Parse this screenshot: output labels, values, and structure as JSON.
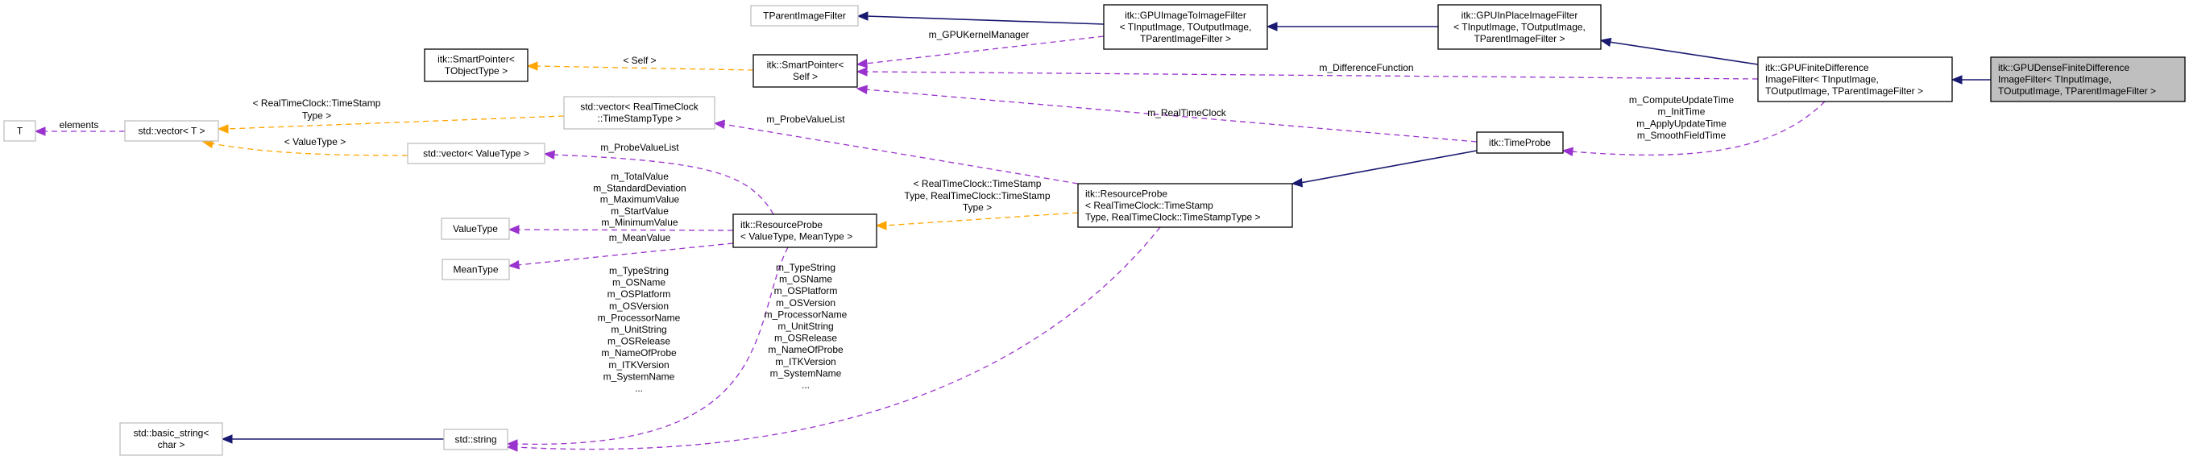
{
  "colors": {
    "inheritance": "#191970",
    "usage": "#9a32cd",
    "template": "#ffa500",
    "focus_fill": "#bfbfbf",
    "external_border": "#bfbfbf"
  },
  "nodes": {
    "dense": {
      "lines": [
        "itk::GPUDenseFiniteDifference",
        "ImageFilter< TInputImage,",
        " TOutputImage, TParentImageFilter >"
      ],
      "style": "focus",
      "align": "left"
    },
    "finite": {
      "lines": [
        "itk::GPUFiniteDifference",
        "ImageFilter< TInputImage,",
        " TOutputImage, TParentImageFilter >"
      ],
      "style": "normal",
      "align": "left"
    },
    "inplace": {
      "lines": [
        "itk::GPUInPlaceImageFilter",
        "< TInputImage, TOutputImage,",
        " TParentImageFilter >"
      ],
      "style": "normal",
      "align": "center"
    },
    "imgtoimg": {
      "lines": [
        "itk::GPUImageToImageFilter",
        "< TInputImage, TOutputImage,",
        " TParentImageFilter >"
      ],
      "style": "normal",
      "align": "center"
    },
    "tparent": {
      "lines": [
        "TParentImageFilter"
      ],
      "style": "ext",
      "align": "center"
    },
    "spself": {
      "lines": [
        "itk::SmartPointer<",
        " Self >"
      ],
      "style": "normal",
      "align": "center"
    },
    "spobj": {
      "lines": [
        "itk::SmartPointer<",
        " TObjectType >"
      ],
      "style": "normal",
      "align": "center"
    },
    "timeprobe": {
      "lines": [
        "itk::TimeProbe"
      ],
      "style": "normal",
      "align": "center"
    },
    "rprtc": {
      "lines": [
        "itk::ResourceProbe",
        "< RealTimeClock::TimeStamp",
        "Type, RealTimeClock::TimeStampType >"
      ],
      "style": "normal",
      "align": "left"
    },
    "rpvm": {
      "lines": [
        "itk::ResourceProbe",
        "< ValueType, MeanType >"
      ],
      "style": "normal",
      "align": "left"
    },
    "vecrtc": {
      "lines": [
        "std::vector< RealTimeClock",
        "::TimeStampType >"
      ],
      "style": "ext",
      "align": "center"
    },
    "vecvt": {
      "lines": [
        "std::vector< ValueType >"
      ],
      "style": "ext",
      "align": "center"
    },
    "vect": {
      "lines": [
        "std::vector< T >"
      ],
      "style": "ext",
      "align": "center"
    },
    "t": {
      "lines": [
        "T"
      ],
      "style": "ext",
      "align": "center"
    },
    "valuetype": {
      "lines": [
        "ValueType"
      ],
      "style": "ext",
      "align": "center"
    },
    "meantype": {
      "lines": [
        "MeanType"
      ],
      "style": "ext",
      "align": "center"
    },
    "stdstring": {
      "lines": [
        "std::string"
      ],
      "style": "ext",
      "align": "center"
    },
    "basicstring": {
      "lines": [
        "std::basic_string<",
        " char >"
      ],
      "style": "ext",
      "align": "center"
    }
  },
  "edges": [
    {
      "id": "e1",
      "from": "imgtoimg",
      "to": "tparent",
      "kind": "inheritance",
      "label": []
    },
    {
      "id": "e2",
      "from": "inplace",
      "to": "imgtoimg",
      "kind": "inheritance",
      "label": []
    },
    {
      "id": "e3",
      "from": "finite",
      "to": "inplace",
      "kind": "inheritance",
      "label": []
    },
    {
      "id": "e4",
      "from": "dense",
      "to": "finite",
      "kind": "inheritance",
      "label": []
    },
    {
      "id": "e5",
      "from": "timeprobe",
      "to": "rprtc",
      "kind": "inheritance",
      "label": []
    },
    {
      "id": "e6",
      "from": "stdstring",
      "to": "basicstring",
      "kind": "inheritance",
      "label": []
    },
    {
      "id": "e7",
      "from": "imgtoimg",
      "to": "spself",
      "kind": "usage",
      "label": [
        "m_GPUKernelManager"
      ]
    },
    {
      "id": "e8",
      "from": "finite",
      "to": "spself",
      "kind": "usage",
      "label": [
        "m_DifferenceFunction"
      ]
    },
    {
      "id": "e9",
      "from": "timeprobe",
      "to": "spself",
      "kind": "usage",
      "label": [
        "m_RealTimeClock"
      ]
    },
    {
      "id": "e10",
      "from": "finite",
      "to": "timeprobe",
      "kind": "usage",
      "label": [
        "m_ComputeUpdateTime",
        "m_InitTime",
        "m_ApplyUpdateTime",
        "m_SmoothFieldTime"
      ]
    },
    {
      "id": "e11",
      "from": "rprtc",
      "to": "vecrtc",
      "kind": "usage",
      "label": [
        "m_ProbeValueList"
      ]
    },
    {
      "id": "e12",
      "from": "rpvm",
      "to": "vecvt",
      "kind": "usage",
      "label": [
        "m_ProbeValueList"
      ]
    },
    {
      "id": "e13",
      "from": "rpvm",
      "to": "valuetype",
      "kind": "usage",
      "label": [
        "m_TotalValue",
        "m_StandardDeviation",
        "m_MaximumValue",
        "m_StartValue",
        "m_MinimumValue"
      ]
    },
    {
      "id": "e14",
      "from": "rpvm",
      "to": "meantype",
      "kind": "usage",
      "label": [
        "m_MeanValue"
      ]
    },
    {
      "id": "e15",
      "from": "rpvm",
      "to": "stdstring",
      "kind": "usage",
      "label": [
        "m_TypeString",
        "m_OSName",
        "m_OSPlatform",
        "m_OSVersion",
        "m_ProcessorName",
        "m_UnitString",
        "m_OSRelease",
        "m_NameOfProbe",
        "m_ITKVersion",
        "m_SystemName",
        "..."
      ]
    },
    {
      "id": "e16",
      "from": "rprtc",
      "to": "stdstring",
      "kind": "usage",
      "label": [
        "m_TypeString",
        "m_OSName",
        "m_OSPlatform",
        "m_OSVersion",
        "m_ProcessorName",
        "m_UnitString",
        "m_OSRelease",
        "m_NameOfProbe",
        "m_ITKVersion",
        "m_SystemName",
        "..."
      ]
    },
    {
      "id": "e17",
      "from": "vect",
      "to": "t",
      "kind": "usage",
      "label": [
        "elements"
      ]
    },
    {
      "id": "e18",
      "from": "spself",
      "to": "spobj",
      "kind": "template",
      "label": [
        "< Self >"
      ]
    },
    {
      "id": "e19",
      "from": "vecrtc",
      "to": "vect",
      "kind": "template",
      "label": [
        "< RealTimeClock::TimeStamp",
        "Type >"
      ]
    },
    {
      "id": "e20",
      "from": "vecvt",
      "to": "vect",
      "kind": "template",
      "label": [
        "< ValueType >"
      ]
    },
    {
      "id": "e21",
      "from": "rprtc",
      "to": "rpvm",
      "kind": "template",
      "label": [
        "< RealTimeClock::TimeStamp",
        "Type, RealTimeClock::TimeStamp",
        "Type >"
      ]
    }
  ]
}
